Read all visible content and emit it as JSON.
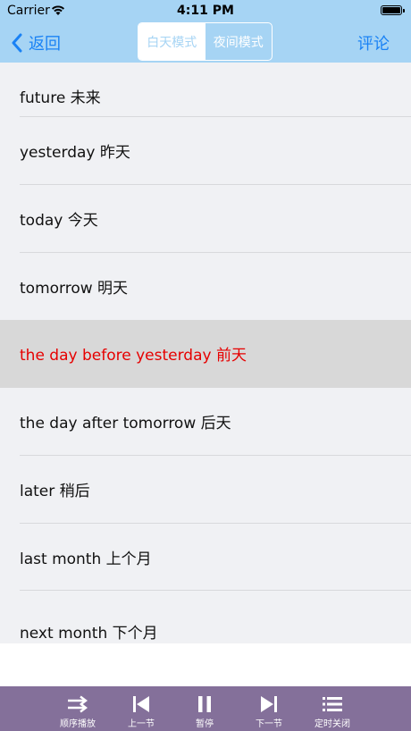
{
  "status_bar": {
    "carrier": "Carrier",
    "time": "4:11 PM"
  },
  "nav": {
    "back_label": "返回",
    "segments": [
      {
        "label": "白天模式",
        "selected": true
      },
      {
        "label": "夜间模式",
        "selected": false
      }
    ],
    "comment_label": "评论"
  },
  "list": {
    "items": [
      {
        "text": "future 未来"
      },
      {
        "text": "yesterday 昨天"
      },
      {
        "text": "today 今天"
      },
      {
        "text": "tomorrow 明天"
      },
      {
        "text": "the day before yesterday 前天",
        "active": true
      },
      {
        "text": "the day after tomorrow 后天"
      },
      {
        "text": "later 稍后"
      },
      {
        "text": "last month 上个月"
      },
      {
        "text": "next month 下个月"
      }
    ]
  },
  "toolbar": {
    "items": [
      {
        "label": "顺序播放",
        "icon": "sequence-play-icon"
      },
      {
        "label": "上一节",
        "icon": "previous-icon"
      },
      {
        "label": "暂停",
        "icon": "pause-icon"
      },
      {
        "label": "下一节",
        "icon": "next-icon"
      },
      {
        "label": "定时关闭",
        "icon": "timer-list-icon"
      }
    ]
  },
  "colors": {
    "nav_background": "#a6d4f4",
    "accent": "#1a82f5",
    "active_text": "#e60000",
    "active_row": "#d8d8d8",
    "list_background": "#f0f1f4",
    "toolbar_background": "#84709a"
  }
}
